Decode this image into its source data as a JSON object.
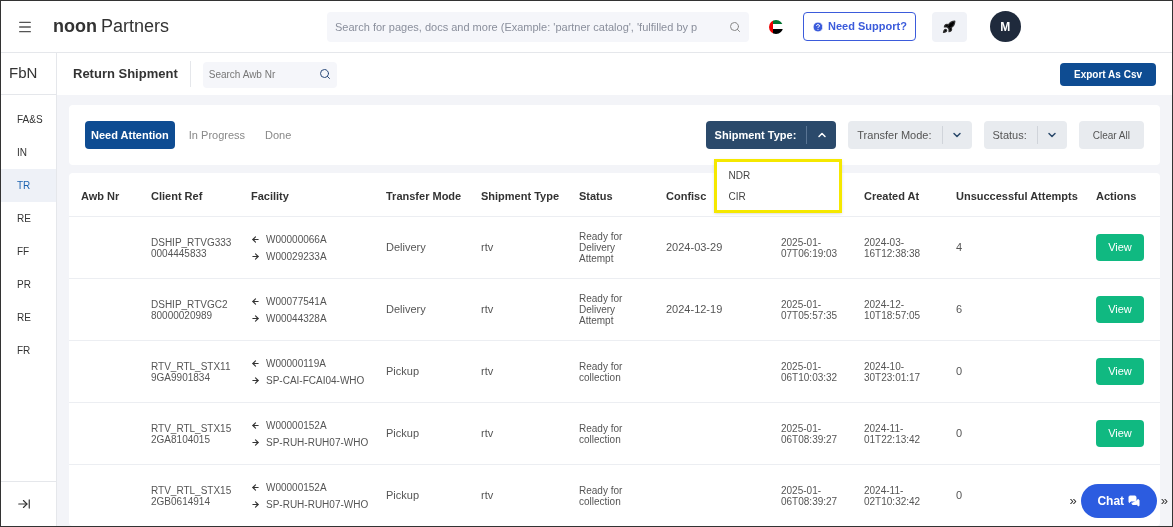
{
  "header": {
    "logo_bold": "noon",
    "logo_rest": "Partners",
    "search_placeholder": "Search for pages, docs and more (Example: 'partner catalog', 'fulfilled by p",
    "support": "Need Support?",
    "avatar": "M"
  },
  "sidebar": {
    "title": "FbN",
    "items": [
      {
        "label": "FA&S",
        "selected": false
      },
      {
        "label": "IN",
        "selected": false
      },
      {
        "label": "TR",
        "selected": true
      },
      {
        "label": "RE",
        "selected": false
      },
      {
        "label": "FF",
        "selected": false
      },
      {
        "label": "PR",
        "selected": false
      },
      {
        "label": "RE",
        "selected": false
      },
      {
        "label": "FR",
        "selected": false
      }
    ]
  },
  "page": {
    "title": "Return Shipment",
    "search_placeholder": "Search Awb Nr",
    "export": "Export As Csv"
  },
  "tabs": [
    {
      "label": "Need Attention",
      "selected": true
    },
    {
      "label": "In Progress",
      "selected": false
    },
    {
      "label": "Done",
      "selected": false
    }
  ],
  "filters": [
    {
      "label": "Shipment Type:",
      "expanded": true
    },
    {
      "label": "Transfer Mode:",
      "expanded": false
    },
    {
      "label": "Status:",
      "expanded": false
    }
  ],
  "clear_all": "Clear All",
  "dropdown": {
    "options": [
      "NDR",
      "CIR"
    ]
  },
  "table": {
    "columns": [
      "Awb Nr",
      "Client Ref",
      "Facility",
      "Transfer Mode",
      "Shipment Type",
      "Status",
      "Confisc",
      "",
      "Created At",
      "Unsuccessful Attempts",
      "Actions"
    ],
    "rows": [
      {
        "client_ref": "DSHIP_RTVG3330004445833",
        "from": "W00000066A",
        "to": "W00029233A",
        "transfer_mode": "Delivery",
        "shipment_type": "rtv",
        "status": "Ready for Delivery Attempt",
        "column_7": "2024-03-29",
        "column_8": "2025-01-07T06:19:03",
        "created_at": "2024-03-16T12:38:38",
        "attempts": "4",
        "action": "View"
      },
      {
        "client_ref": "DSHIP_RTVGC280000020989",
        "from": "W00077541A",
        "to": "W00044328A",
        "transfer_mode": "Delivery",
        "shipment_type": "rtv",
        "status": "Ready for Delivery Attempt",
        "column_7": "2024-12-19",
        "column_8": "2025-01-07T05:57:35",
        "created_at": "2024-12-10T18:57:05",
        "attempts": "6",
        "action": "View"
      },
      {
        "client_ref": "RTV_RTL_STX119GA9901834",
        "from": "W00000119A",
        "to": "SP-CAI-FCAI04-WHO",
        "transfer_mode": "Pickup",
        "shipment_type": "rtv",
        "status": "Ready for collection",
        "column_8": "2025-01-06T10:03:32",
        "created_at": "2024-10-30T23:01:17",
        "attempts": "0",
        "action": "View"
      },
      {
        "client_ref": "RTV_RTL_STX152GA8104015",
        "from": "W00000152A",
        "to": "SP-RUH-RUH07-WHO",
        "transfer_mode": "Pickup",
        "shipment_type": "rtv",
        "status": "Ready for collection",
        "column_8": "2025-01-06T08:39:27",
        "created_at": "2024-11-01T22:13:42",
        "attempts": "0",
        "action": "View"
      },
      {
        "client_ref": "RTV_RTL_STX152GB0614914",
        "from": "W00000152A",
        "to": "SP-RUH-RUH07-WHO",
        "transfer_mode": "Pickup",
        "shipment_type": "rtv",
        "status": "Ready for collection",
        "column_8": "2025-01-06T08:39:27",
        "created_at": "2024-11-02T10:32:42",
        "attempts": "0"
      }
    ]
  },
  "chat": {
    "label": "Chat",
    "left": "»",
    "right": "»"
  }
}
